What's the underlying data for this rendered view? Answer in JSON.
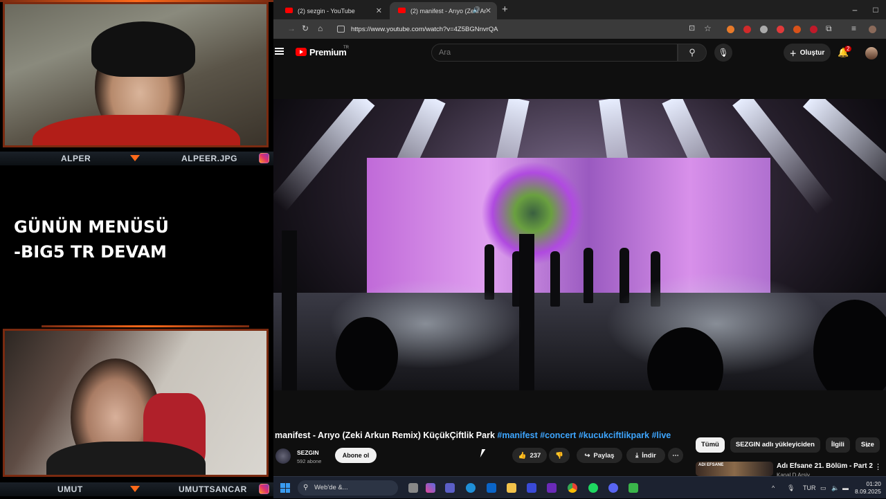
{
  "overlay": {
    "cam1": {
      "name_left": "ALPER",
      "name_right": "ALPEER.JPG"
    },
    "cam2": {
      "name_left": "UMUT",
      "name_right": "UMUTTSANCAR"
    },
    "menu_text": "GÜNÜN MENÜSÜ\n-BIG5 TR DEVAM"
  },
  "browser": {
    "tabs": [
      {
        "label": "(2) sezgin - YouTube"
      },
      {
        "label": "(2) manifest - Arıyo (Zeki Ar"
      }
    ],
    "new_tab": "+",
    "url": "https://www.youtube.com/watch?v=4Z5BGNnvrQA",
    "window_controls": [
      "–",
      "□"
    ]
  },
  "youtube": {
    "logo_text": "Premium",
    "region": "TR",
    "search_placeholder": "Ara",
    "create_label": "Oluştur",
    "notification_count": "2",
    "video": {
      "title_plain": "manifest - Arıyo (Zeki Arkun Remix) KüçükÇiftlik Park",
      "hashtags": [
        "#manifest",
        "#concert",
        "#kucukciftlikpark",
        "#live"
      ],
      "channel": "SEZGIN",
      "subscribers": "592 abone",
      "subscribe_label": "Abone ol",
      "likes": "237",
      "share_label": "Paylaş",
      "download_label": "İndir",
      "more_label": "⋯"
    },
    "chips": [
      "Tümü",
      "SEZGIN adlı yükleyiciden",
      "İlgili",
      "Size"
    ],
    "recommended": {
      "title": "Adı Efsane 21. Bölüm - Part 2",
      "channel": "Kanal D Arşiv",
      "thumb_text": "ADI EFSANE"
    }
  },
  "taskbar": {
    "search_label": "Web'de &...",
    "language": "TUR",
    "time": "01:20",
    "date": "8.09.2025"
  },
  "colors": {
    "accent_orange": "#ff6a1a",
    "yt_red": "#ff0000",
    "link_blue": "#3ea6ff"
  }
}
